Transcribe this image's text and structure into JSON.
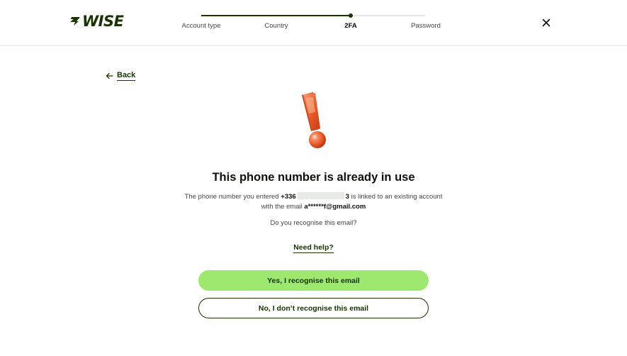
{
  "brand": {
    "logo_text": "WISE",
    "color": "#163300",
    "accent": "#9fe870"
  },
  "stepper": {
    "steps": [
      {
        "label": "Account type"
      },
      {
        "label": "Country"
      },
      {
        "label": "2FA"
      },
      {
        "label": "Password"
      }
    ],
    "active_index": 2
  },
  "nav": {
    "back_label": "Back",
    "close_icon": "close-icon"
  },
  "content": {
    "illustration": "exclamation-mark-illustration",
    "title": "This phone number is already in use",
    "line1_prefix": "The phone number you entered",
    "phone_prefix": "+336",
    "phone_suffix": "3",
    "line1_suffix": "is linked to an existing account",
    "line2_prefix": "with the email",
    "email": "a******f@gmail.com",
    "question": "Do you recognise this email?",
    "help_link": "Need help?"
  },
  "actions": {
    "primary": "Yes, I recognise this email",
    "secondary": "No, I don’t recognise this email"
  }
}
